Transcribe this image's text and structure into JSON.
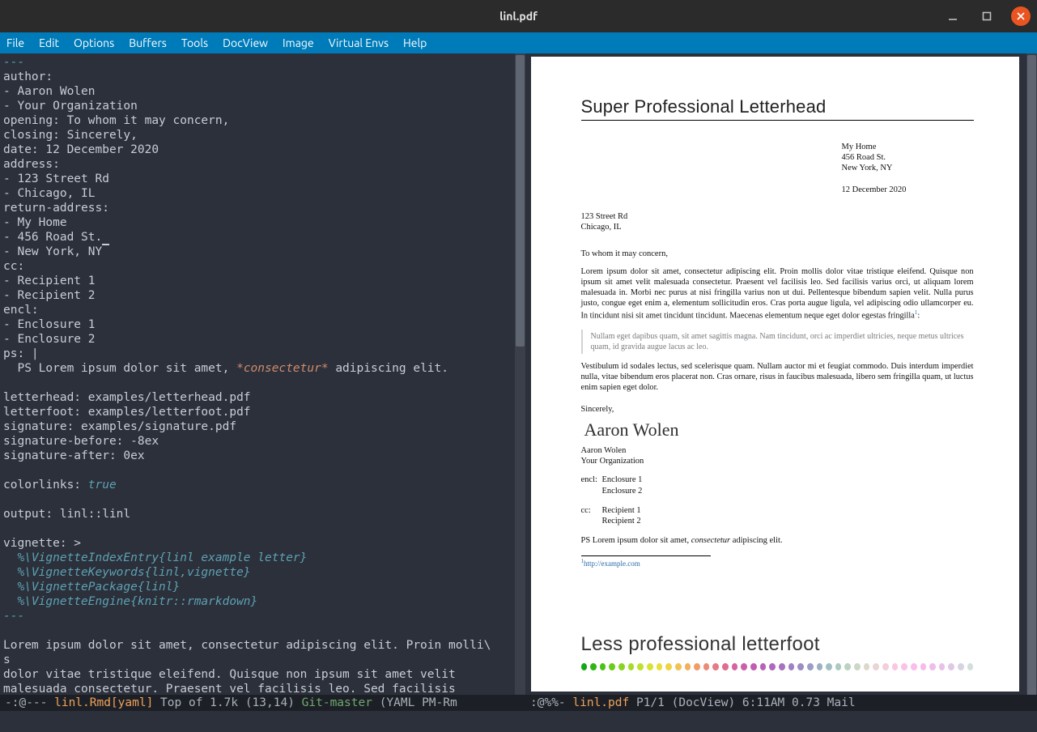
{
  "window": {
    "title": "linl.pdf"
  },
  "menu": [
    "File",
    "Edit",
    "Options",
    "Buffers",
    "Tools",
    "DocView",
    "Image",
    "Virtual Envs",
    "Help"
  ],
  "editor": {
    "dashes": "---",
    "lines_pre": [
      "author:",
      "- Aaron Wolen",
      "- Your Organization",
      "opening: To whom it may concern,",
      "closing: Sincerely,",
      "date: 12 December 2020",
      "address:",
      "- 123 Street Rd",
      "- Chicago, IL",
      "return-address:",
      "- My Home",
      "- 456 Road St."
    ],
    "cursor_line_prefix": "- New York, NY",
    "lines_mid": [
      "cc:",
      "- Recipient 1",
      "- Recipient 2",
      "encl:",
      "- Enclosure 1",
      "- Enclosure 2",
      "ps: |"
    ],
    "ps_prefix": "  PS Lorem ipsum dolor sit amet, ",
    "ps_em": "*consectetur*",
    "ps_suffix": " adipiscing elit.",
    "blank": "",
    "lines_after": [
      "letterhead: examples/letterhead.pdf",
      "letterfoot: examples/letterfoot.pdf",
      "signature: examples/signature.pdf",
      "signature-before: -8ex",
      "signature-after: 0ex"
    ],
    "colorlinks_key": "colorlinks: ",
    "colorlinks_val": "true",
    "output_line": "output: linl::linl",
    "vignette_head": "vignette: >",
    "vignette_lines": [
      "  %\\VignetteIndexEntry{linl example letter}",
      "  %\\VignetteKeywords{linl,vignette}",
      "  %\\VignettePackage{linl}",
      "  %\\VignetteEngine{knitr::rmarkdown}"
    ],
    "body_lines": [
      "Lorem ipsum dolor sit amet, consectetur adipiscing elit. Proin molli\\",
      "s",
      "dolor vitae tristique eleifend. Quisque non ipsum sit amet velit",
      "malesuada consectetur. Praesent vel facilisis leo. Sed facilisis"
    ]
  },
  "modeline": {
    "left_prefix": " -:@---  ",
    "left_buf": "linl.Rmd[yaml]",
    "left_mid": "   Top of 1.7k (13,14)   ",
    "left_git": "Git-master",
    "left_suffix": "  (YAML PM-Rm",
    "right_prefix": " :@%%-  ",
    "right_buf": "linl.pdf",
    "right_suffix": "        P1/1  (DocView) 6:11AM 0.73 Mail"
  },
  "pdf": {
    "letterhead": "Super Professional Letterhead",
    "return_address": [
      "My Home",
      "456 Road St.",
      "New York, NY"
    ],
    "date": "12 December 2020",
    "to_address": [
      "123 Street Rd",
      "Chicago, IL"
    ],
    "opening": "To whom it may concern,",
    "para1": "Lorem ipsum dolor sit amet, consectetur adipiscing elit. Proin mollis dolor vitae tristique eleifend. Quisque non ipsum sit amet velit malesuada consectetur. Praesent vel facilisis leo. Sed facilisis varius orci, ut aliquam lorem malesuada in. Morbi nec purus at nisi fringilla varius non ut dui. Pellentesque bibendum sapien velit. Nulla purus justo, congue eget enim a, elementum sollicitudin eros.  Cras porta augue ligula, vel adipiscing odio ullamcorper eu.  In tincidunt nisi sit amet tincidunt tincidunt. Maecenas elementum neque eget dolor egestas fringilla",
    "para1_tail": ":",
    "quote": "Nullam eget dapibus quam, sit amet sagittis magna. Nam tincidunt, orci ac imperdiet ultricies, neque metus ultrices quam, id gravida augue lacus ac leo.",
    "para2": "Vestibulum id sodales lectus, sed scelerisque quam.  Nullam auctor mi et feugiat commodo. Duis interdum imperdiet nulla, vitae bibendum eros placerat non. Cras ornare, risus in faucibus malesuada, libero sem fringilla quam, ut luctus enim sapien eget dolor.",
    "closing": "Sincerely,",
    "signature_name": "Aaron Wolen",
    "from": [
      "Aaron Wolen",
      "Your Organization"
    ],
    "encl_label": "encl:",
    "encl": [
      "Enclosure 1",
      "Enclosure 2"
    ],
    "cc_label": "cc:",
    "cc": [
      "Recipient 1",
      "Recipient 2"
    ],
    "ps_prefix": "PS Lorem ipsum dolor sit amet, ",
    "ps_em": "consectetur",
    "ps_suffix": " adipiscing elit.",
    "footnote_num": "1",
    "footnote_url": "http://example.com",
    "letterfoot": "Less professional letterfoot",
    "dot_colors": [
      "#13a713",
      "#2eb514",
      "#4cc217",
      "#6acc1c",
      "#88d521",
      "#a4dc28",
      "#bfe12e",
      "#d6e335",
      "#e7df3c",
      "#efd345",
      "#f2c250",
      "#f2af5c",
      "#f09c69",
      "#ec8a77",
      "#e67a85",
      "#de6d92",
      "#d5649e",
      "#cb5fa9",
      "#c15eb1",
      "#b761b8",
      "#ae68bd",
      "#a672c1",
      "#a07fc3",
      "#9c8ec4",
      "#9b9ec4",
      "#9dafc3",
      "#a3bec1",
      "#adcac0",
      "#bbd3c1",
      "#cbd8c5",
      "#dcd9cc",
      "#ead5d4",
      "#f3cedc",
      "#f9c7e3",
      "#fbc1e8",
      "#fabdec",
      "#f6bbed",
      "#f0bcec",
      "#e8c1ea",
      "#e0c9e6",
      "#d8d3e1",
      "#d2dfdd"
    ]
  }
}
